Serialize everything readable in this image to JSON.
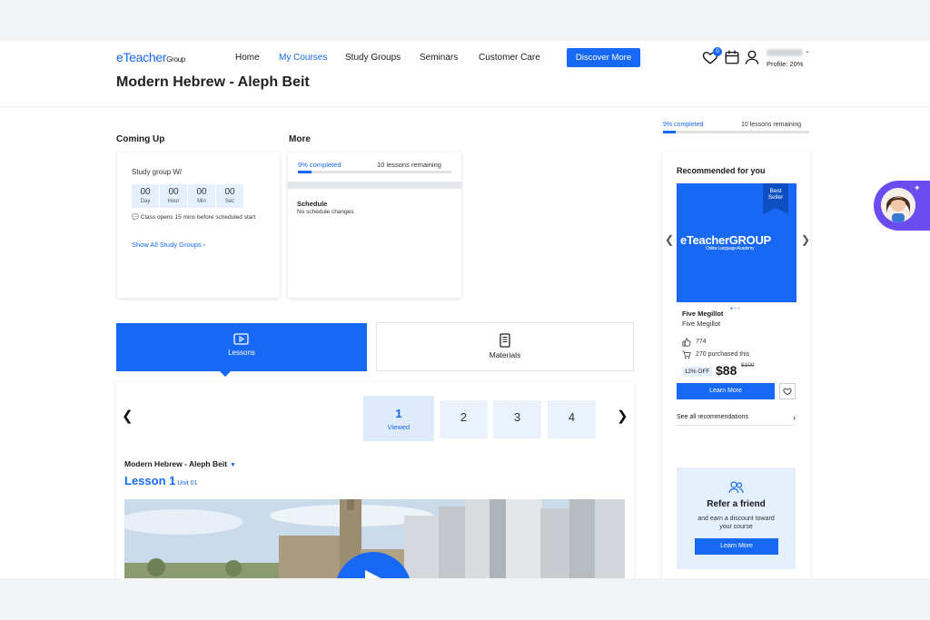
{
  "header": {
    "logo_main": "eTeacher",
    "logo_group": "Group",
    "nav": [
      "Home",
      "My Courses",
      "Study Groups",
      "Seminars",
      "Customer Care"
    ],
    "active_nav": "My Courses",
    "discover_label": "Discover More",
    "wishlist_count": "0",
    "profile_text": "Profile: 20%",
    "icons": [
      "heart-icon",
      "calendar-icon",
      "user-icon"
    ]
  },
  "page_title": "Modern Hebrew - Aleph Beit",
  "coming_up": {
    "label": "Coming Up",
    "study_group_title": "Study group W/",
    "countdown": [
      {
        "value": "00",
        "unit": "Day"
      },
      {
        "value": "00",
        "unit": "Hour"
      },
      {
        "value": "00",
        "unit": "Min"
      },
      {
        "value": "00",
        "unit": "Sec"
      }
    ],
    "class_note": "Class opens 15 mins before scheduled start",
    "show_all": "Show All Study Groups ›"
  },
  "more": {
    "label": "More",
    "completed": "9% completed",
    "remaining": "10 lessons remaining",
    "progress": 0.09,
    "schedule_title": "Schedule",
    "schedule_text": "No schedule changes"
  },
  "tabs": {
    "lessons": "Lessons",
    "materials": "Materials"
  },
  "lessons": {
    "numbers": [
      "1",
      "2",
      "3",
      "4"
    ],
    "active_status": "Viewed",
    "course_select": "Modern Hebrew - Aleph Beit",
    "lesson_title": "Lesson 1",
    "unit": "Unit 01"
  },
  "right": {
    "completed": "9% completed",
    "remaining": "10 lessons remaining",
    "progress": 0.09,
    "recommended_title": "Recommended for you",
    "best_seller": "Best Seller",
    "product_logo": "eTeacherGROUP",
    "product_logo_sub": "Online Language Academy",
    "product_name": "Five Megillot",
    "product_subtitle": "Five Megillot",
    "likes": "774",
    "purchased": "270 purchased this",
    "discount": "12% OFF",
    "price": "$88",
    "old_price": "$100",
    "learn_more": "Learn More",
    "see_all": "See all recommendations",
    "refer_title": "Refer a friend",
    "refer_text": "and earn a discount toward your course",
    "refer_button": "Learn More"
  },
  "colors": {
    "accent": "#1769f5",
    "light_accent": "#e5f0fd",
    "assistant": "#6b4cf0"
  }
}
